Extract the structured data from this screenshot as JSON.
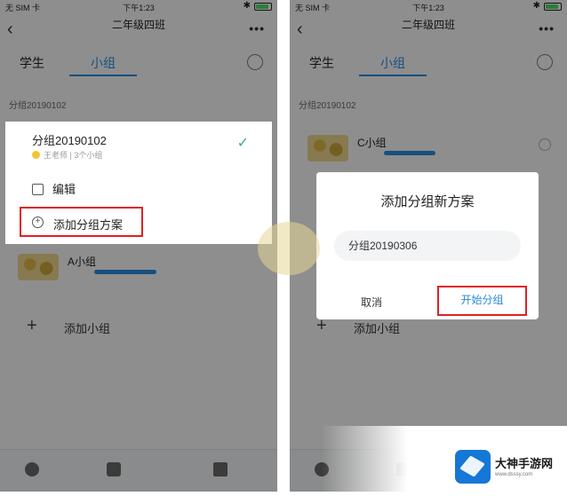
{
  "left_screen": {
    "status": {
      "carrier": "无 SIM 卡",
      "time": "下午1:23"
    },
    "nav": {
      "title": "二年级四班"
    },
    "tabs": [
      {
        "label": "学生"
      },
      {
        "label": "小组"
      }
    ],
    "scheme_label": "分组20190102",
    "groups": [
      {
        "name": "A小组"
      }
    ],
    "add_group": "添加小组",
    "popup": {
      "scheme_name": "分组20190102",
      "scheme_meta": "王老师 | 3个小组",
      "edit": "编辑",
      "add_scheme": "添加分组方案"
    }
  },
  "right_screen": {
    "status": {
      "carrier": "无 SIM 卡",
      "time": "下午1:23"
    },
    "nav": {
      "title": "二年级四班"
    },
    "tabs": [
      {
        "label": "学生"
      },
      {
        "label": "小组"
      }
    ],
    "scheme_label": "分组20190102",
    "groups": [
      {
        "name": "C小组"
      }
    ],
    "add_group": "添加小组",
    "dialog": {
      "title": "添加分组新方案",
      "input_value": "分组20190306",
      "cancel": "取消",
      "start": "开始分组"
    }
  },
  "watermark": {
    "name": "大神手游网",
    "url": "www.dsssy.com"
  },
  "colors": {
    "accent": "#2a8bd8",
    "highlight_box": "#e02020",
    "check": "#2fb08a"
  }
}
